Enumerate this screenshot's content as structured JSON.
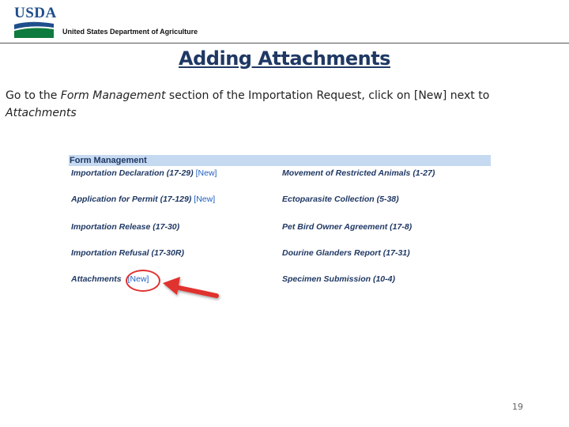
{
  "header": {
    "logo_text": "USDA",
    "department": "United States Department of Agriculture"
  },
  "slide": {
    "title": "Adding Attachments",
    "instruction": {
      "part1": "Go to the ",
      "section_name": "Form Management",
      "part2": " section of the Importation Request, click on [New] next to ",
      "target": "Attachments"
    },
    "page_number": "19"
  },
  "form_management": {
    "heading": "Form Management",
    "new_label": "[New]",
    "left_column": [
      {
        "label": "Importation Declaration (17-29)",
        "has_new": true
      },
      {
        "label": "Application for Permit (17-129)",
        "has_new": true
      },
      {
        "label": "Importation Release (17-30)",
        "has_new": false
      },
      {
        "label": "Importation Refusal (17-30R)",
        "has_new": false
      },
      {
        "label": "Attachments",
        "has_new": true
      }
    ],
    "right_column": [
      {
        "label": "Movement of Restricted Animals (1-27)"
      },
      {
        "label": "Ectoparasite Collection (5-38)"
      },
      {
        "label": "Pet Bird Owner Agreement (17-8)"
      },
      {
        "label": "Dourine Glanders Report (17-31)"
      },
      {
        "label": "Specimen Submission (10-4)"
      }
    ]
  },
  "colors": {
    "highlight": "#e0312f",
    "heading_bar": "#c5d9f1",
    "title": "#1f3864"
  }
}
